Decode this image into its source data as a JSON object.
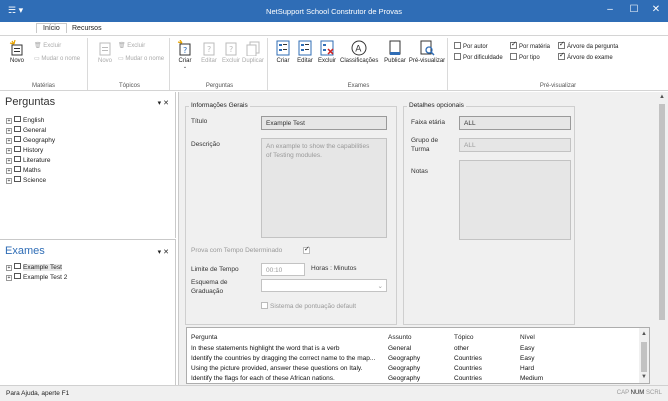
{
  "window": {
    "title": "NetSupport School Construtor de Provas",
    "qa_label": "☴ ▾",
    "minimize_glyph": "–",
    "maximize_glyph": "☐",
    "close_glyph": "✕"
  },
  "tabs": [
    "Início",
    "Recursos"
  ],
  "ribbon": {
    "materias": {
      "label": "Matérias",
      "novo": "Novo",
      "excluir": "Excluir",
      "mudar_nome": "Mudar o nome"
    },
    "topicos": {
      "label": "Tópicos",
      "novo": "Novo",
      "excluir": "Excluir",
      "mudar_nome": "Mudar o nome"
    },
    "perguntas": {
      "label": "Perguntas",
      "criar": "Criar",
      "editar": "Editar",
      "excluir": "Excluir",
      "duplicar": "Duplicar"
    },
    "exames": {
      "label": "Exames",
      "criar": "Criar",
      "editar": "Editar",
      "excluir": "Excluir",
      "classificacoes": "Classificações",
      "publicar": "Publicar",
      "previsualizar": "Pré-visualizar"
    },
    "previsualizar": {
      "label": "Pré-visualizar",
      "por_autor": "Por autor",
      "por_dificuldade": "Por dificuldade",
      "por_materia": "Por matéria",
      "por_tipo": "Por tipo",
      "arvore_pergunta": "Árvore da pergunta",
      "arvore_exame": "Árvore do exame"
    }
  },
  "perguntas_pane": {
    "title": "Perguntas",
    "controls": "▾ ✕",
    "items": [
      "English",
      "General",
      "Geography",
      "History",
      "Literature",
      "Maths",
      "Science"
    ]
  },
  "exames_pane": {
    "title": "Exames",
    "controls": "▾ ✕",
    "items": [
      "Example Test",
      "Example Test 2"
    ]
  },
  "info_geral": {
    "title": "Informações Gerais",
    "titulo_label": "Título",
    "titulo_value": "Example Test",
    "descricao_label": "Descrição",
    "descricao_value": "An example to show the capabilities of Testing modules.",
    "prova_tempo_label": "Prova com Tempo Determinado",
    "limite_label": "Limite de Tempo",
    "limite_value": "00:10",
    "horas_label": "Horas : Minutos",
    "esquema_label": "Esquema de Graduação",
    "sistema_label": "Sistema de pontuação default"
  },
  "detalhes": {
    "title": "Detalhes opcionais",
    "faixa_label": "Faixa etária",
    "faixa_value": "ALL",
    "grupo_label": "Grupo de Turma",
    "grupo_value": "ALL",
    "notas_label": "Notas"
  },
  "question_list": {
    "headers": [
      "Pergunta",
      "Assunto",
      "Tópico",
      "Nível"
    ],
    "rows": [
      [
        "In these statements highlight the word that is a verb",
        "General",
        "other",
        "Easy"
      ],
      [
        "Identify the countries by dragging the correct name to the map...",
        "Geography",
        "Countries",
        "Easy"
      ],
      [
        "Using the picture provided, answer these questions on Italy.",
        "Geography",
        "Countries",
        "Hard"
      ],
      [
        "Identify the flags for each of these African nations.",
        "Geography",
        "Countries",
        "Medium"
      ]
    ]
  },
  "status": {
    "help": "Para Ajuda, aperte F1",
    "cap": "CAP",
    "num": "NUM",
    "scrl": "SCRL"
  },
  "colors": {
    "titlebar": "#2f6db6",
    "accent_blue": "#2f6db6"
  }
}
